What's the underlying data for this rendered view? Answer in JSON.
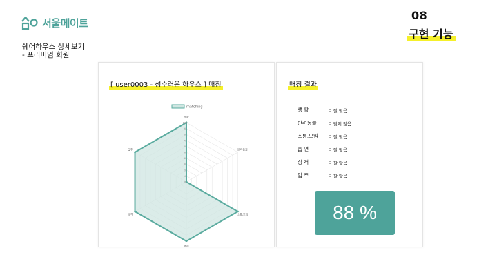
{
  "brand": {
    "name": "서울메이트",
    "color": "#4ea39a"
  },
  "page": {
    "subtitle_line1": "쉐어하우스 상세보기",
    "subtitle_line2": "- 프리미엄 회원"
  },
  "section": {
    "number": "08",
    "title": "구현 기능",
    "highlight_color": "#f5f02a"
  },
  "left_card": {
    "heading": "[ user0003 - 성수러운 하우스 ] 매칭"
  },
  "right_card": {
    "heading": "매칭 결과",
    "results": [
      {
        "label": "생 활",
        "sep": ":",
        "value": "잘 맞음"
      },
      {
        "label": "반려동물",
        "sep": ":",
        "value": "맞지 않음"
      },
      {
        "label": "소통,모임",
        "sep": ":",
        "value": "잘 맞음"
      },
      {
        "label": "흡 연",
        "sep": ":",
        "value": "잘 맞음"
      },
      {
        "label": "성 격",
        "sep": ":",
        "value": "잘 맞음"
      },
      {
        "label": "입 주",
        "sep": ":",
        "value": "잘 맞음"
      }
    ],
    "score": "88 %"
  },
  "chart_data": {
    "type": "radar",
    "legend": [
      "matching"
    ],
    "axes": [
      "생활",
      "반려동물",
      "소통,모임",
      "흡연",
      "성격",
      "입주"
    ],
    "series": [
      {
        "name": "matching",
        "values": [
          100,
          0,
          100,
          100,
          100,
          100
        ]
      }
    ],
    "rlim": [
      0,
      100
    ],
    "tick_labels": [
      "100",
      "90",
      "80",
      "70",
      "60",
      "50",
      "40",
      "30",
      "20",
      "10",
      "0"
    ],
    "colors": {
      "stroke": "#5aab9f",
      "fill": "#cfe6e1"
    }
  }
}
